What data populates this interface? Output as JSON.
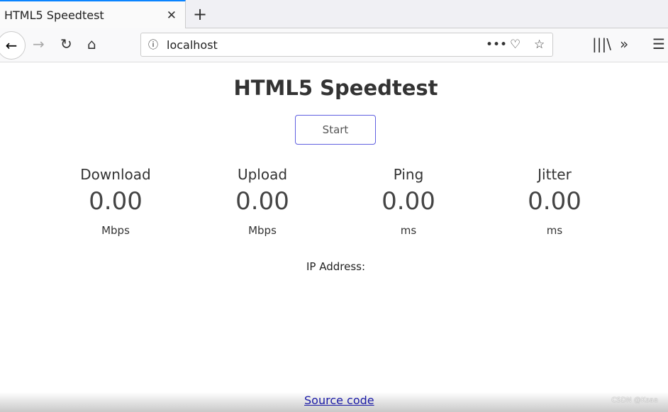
{
  "browser": {
    "tab_title": "HTML5 Speedtest",
    "url": "localhost"
  },
  "page": {
    "title": "HTML5 Speedtest",
    "start_label": "Start",
    "metrics": [
      {
        "label": "Download",
        "value": "0.00",
        "unit": "Mbps"
      },
      {
        "label": "Upload",
        "value": "0.00",
        "unit": "Mbps"
      },
      {
        "label": "Ping",
        "value": "0.00",
        "unit": "ms"
      },
      {
        "label": "Jitter",
        "value": "0.00",
        "unit": "ms"
      }
    ],
    "ip_label": "IP Address:",
    "source_link": "Source code"
  },
  "watermark": "CSDN @Ksaa"
}
